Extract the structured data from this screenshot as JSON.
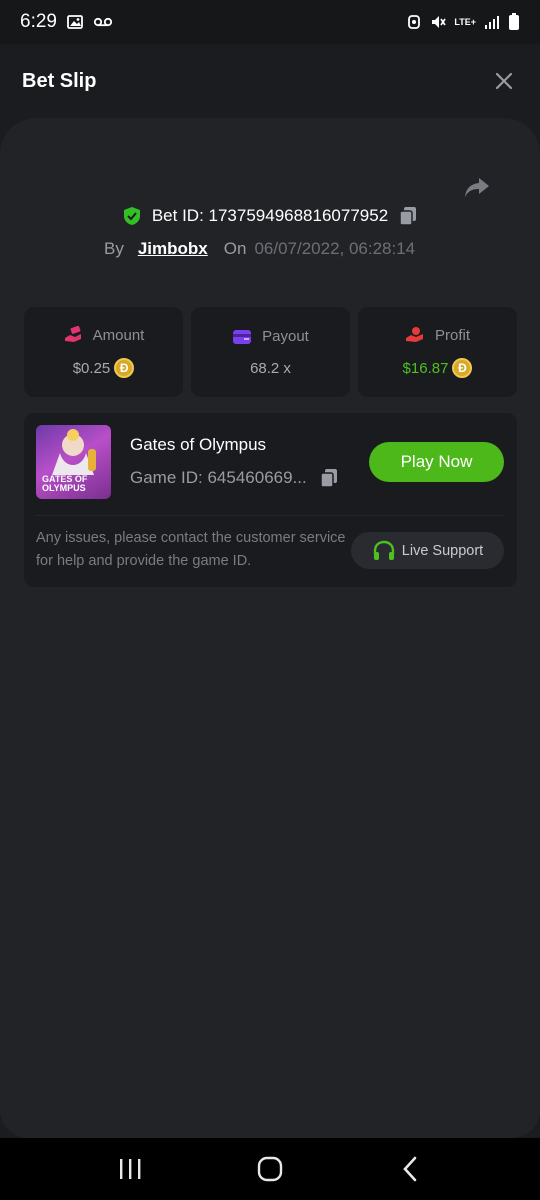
{
  "status_bar": {
    "time": "6:29",
    "network": "LTE+"
  },
  "header": {
    "title": "Bet Slip"
  },
  "bet": {
    "id_label": "Bet ID: 1737594968816077952",
    "by_label": "By",
    "username": "Jimbobx",
    "on_label": "On",
    "date": "06/07/2022, 06:28:14"
  },
  "stats": {
    "amount": {
      "label": "Amount",
      "value": "$0.25"
    },
    "payout": {
      "label": "Payout",
      "value": "68.2 x"
    },
    "profit": {
      "label": "Profit",
      "value": "$16.87"
    }
  },
  "coin_symbol": "Ð",
  "game": {
    "thumb_text_line1": "GATES OF",
    "thumb_text_line2": "OLYMPUS",
    "name": "Gates of Olympus",
    "id_label": "Game ID: 645460669...",
    "play_label": "Play Now"
  },
  "support": {
    "notice": "Any issues, please contact the customer service for help and provide the game ID.",
    "button_label": "Live Support"
  },
  "colors": {
    "accent_green": "#4cb81a",
    "profit_green": "#4cc21f",
    "background": "#1b1c1f",
    "card": "#1a1b1e"
  },
  "icons": {
    "share": "share-icon",
    "verified": "shield-check-icon",
    "copy": "copy-icon",
    "amount": "money-hand-icon",
    "payout": "wallet-icon",
    "profit": "profit-hand-icon",
    "headset": "headset-icon",
    "close": "close-icon"
  }
}
